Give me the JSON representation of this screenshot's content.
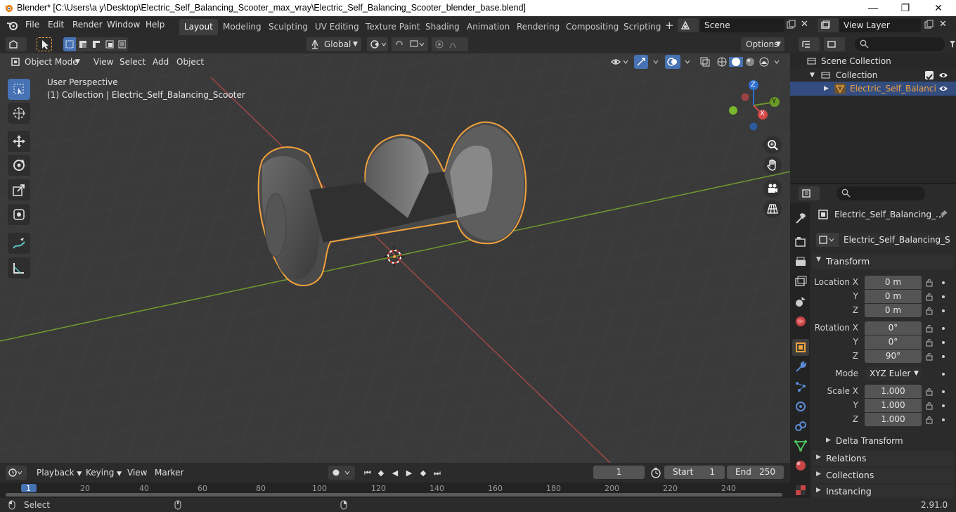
{
  "window": {
    "title": "Blender* [C:\\Users\\a y\\Desktop\\Electric_Self_Balancing_Scooter_max_vray\\Electric_Self_Balancing_Scooter_blender_base.blend]",
    "minimize": "—",
    "maximize": "❐",
    "close": "✕"
  },
  "menubar": {
    "items": [
      "File",
      "Edit",
      "Render",
      "Window",
      "Help"
    ]
  },
  "workspaces": {
    "tabs": [
      "Layout",
      "Modeling",
      "Sculpting",
      "UV Editing",
      "Texture Paint",
      "Shading",
      "Animation",
      "Rendering",
      "Compositing",
      "Scripting"
    ],
    "active": "Layout",
    "add": "+"
  },
  "scene": {
    "name": "Scene"
  },
  "view_layer": {
    "name": "View Layer"
  },
  "toolbar_header": {
    "orientation": "Global",
    "options": "Options"
  },
  "viewport_header": {
    "mode": "Object Mode",
    "menus": [
      "View",
      "Select",
      "Add",
      "Object"
    ]
  },
  "viewport": {
    "perspective": "User Perspective",
    "collection_info": "(1) Collection | Electric_Self_Balancing_Scooter",
    "gizmo": {
      "x": "X",
      "y": "Y",
      "z": "Z"
    }
  },
  "outliner": {
    "scene_collection": "Scene Collection",
    "collection": "Collection",
    "object": "Electric_Self_Balanci"
  },
  "properties": {
    "object_name": "Electric_Self_Balancing_...",
    "data_name": "Electric_Self_Balancing_Sco...",
    "transform": {
      "title": "Transform",
      "location_label": "Location X",
      "rotation_label": "Rotation X",
      "scale_label": "Scale X",
      "y_label": "Y",
      "z_label": "Z",
      "location": [
        "0 m",
        "0 m",
        "0 m"
      ],
      "rotation": [
        "0°",
        "0°",
        "90°"
      ],
      "mode_label": "Mode",
      "mode": "XYZ Euler",
      "scale": [
        "1.000",
        "1.000",
        "1.000"
      ]
    },
    "sections": [
      "Delta Transform",
      "Relations",
      "Collections",
      "Instancing"
    ]
  },
  "timeline": {
    "menus": [
      "Playback",
      "Keying",
      "View",
      "Marker"
    ],
    "current_frame": "1",
    "start_label": "Start",
    "start": "1",
    "end_label": "End",
    "end": "250",
    "ruler": [
      "1",
      "20",
      "40",
      "60",
      "80",
      "100",
      "120",
      "140",
      "160",
      "180",
      "200",
      "220",
      "240"
    ]
  },
  "statusbar": {
    "left": "Select",
    "version": "2.91.0"
  },
  "colors": {
    "accent": "#4772b3",
    "selection_outline": "#f2a23c",
    "header": "#2b2b2b",
    "viewport_bg": "#3a3a3a"
  }
}
